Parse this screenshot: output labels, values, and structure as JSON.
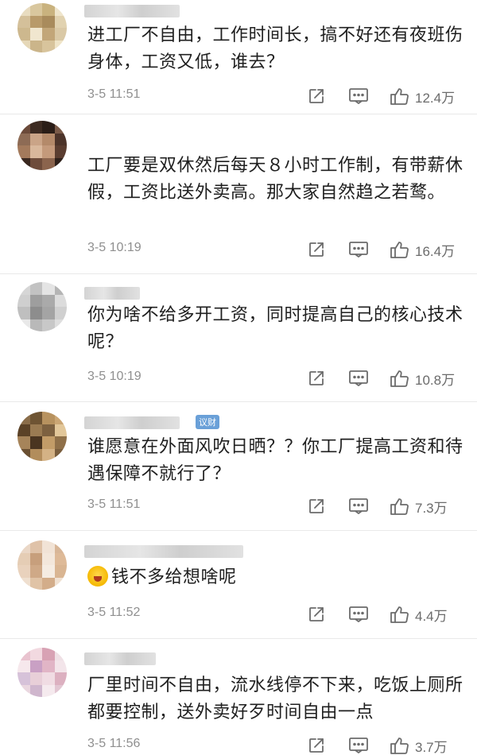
{
  "comments": [
    {
      "text": "进工厂不自由，工作时间长，搞不好还有夜班伤身体，工资又低，谁去？",
      "time": "3-5 11:51",
      "likes": "12.4万",
      "avatar_colors": [
        "#e8dcc0",
        "#d9c79e",
        "#c9b27e",
        "#efe5cc",
        "#d4c09a",
        "#b89a6a",
        "#a98b5c",
        "#e1d2b0",
        "#cdb88e",
        "#f0e6cf",
        "#c2a679",
        "#dac9a6",
        "#e6d8b8",
        "#cbb58a",
        "#d8c49c",
        "#efe4c8"
      ],
      "username_width": 120
    },
    {
      "text": "工厂要是双休然后每天８小时工作制，有带薪休假，工资比送外卖高。那大家自然趋之若鹜。",
      "time": "3-5 10:19",
      "likes": "16.4万",
      "avatar_colors": [
        "#6b4a3a",
        "#3d2b22",
        "#2a1d17",
        "#7a5a48",
        "#8d6b55",
        "#caa487",
        "#b48a6a",
        "#4c342a",
        "#a37a5c",
        "#d9b89c",
        "#c49a7b",
        "#5a3d30",
        "#3a2820",
        "#6e4c3b",
        "#8b644d",
        "#2f211b"
      ],
      "username_width": 0
    },
    {
      "text": "你为啥不给多开工资，同时提高自己的核心技术呢？",
      "time": "3-5 10:19",
      "likes": "10.8万",
      "avatar_colors": [
        "#d6d6d6",
        "#c2c2c2",
        "#e4e4e4",
        "#b5b5b5",
        "#cfcfcf",
        "#9e9e9e",
        "#aaaaaa",
        "#dcdcdc",
        "#bfbfbf",
        "#8d8d8d",
        "#a4a4a4",
        "#d0d0d0",
        "#e9e9e9",
        "#b9b9b9",
        "#c8c8c8",
        "#dedede"
      ],
      "username_width": 70
    },
    {
      "text": "谁愿意在外面风吹日晒？？你工厂提高工资和待遇保障不就行了？",
      "time": "3-5 11:51",
      "likes": "7.3万",
      "avatar_colors": [
        "#8a6d4a",
        "#6e5433",
        "#b7925f",
        "#cba674",
        "#5b4227",
        "#9a7b52",
        "#7d6140",
        "#e2c79a",
        "#a6845a",
        "#4a3520",
        "#c29c68",
        "#8f7049",
        "#6a5032",
        "#b28d5c",
        "#d4b285",
        "#7a5e3d"
      ],
      "username_width": 120,
      "badge": "议财"
    },
    {
      "text": "钱不多给想啥呢",
      "emoji": "scared-face",
      "time": "3-5 11:52",
      "likes": "4.4万",
      "avatar_colors": [
        "#ead7c6",
        "#dfc2a8",
        "#f1e3d6",
        "#d8b697",
        "#e5cdb5",
        "#c79f7c",
        "#f3e7db",
        "#deba98",
        "#e9d2bd",
        "#cfa987",
        "#f5ece2",
        "#d9b592",
        "#efdfcf",
        "#e0c3a6",
        "#d3ad8a",
        "#f0e1d2"
      ],
      "username_width": 200
    },
    {
      "text": "厂里时间不自由，流水线停不下来，吃饭上厕所都要控制，送外卖好歹时间自由一点",
      "time": "3-5 11:56",
      "likes": "3.7万",
      "avatar_colors": [
        "#e9c3cf",
        "#f2d9e0",
        "#d8a2b4",
        "#efe0e5",
        "#f6e8ec",
        "#c9a0c4",
        "#e1b5c6",
        "#f3e5ea",
        "#d6c2d9",
        "#e8cfd8",
        "#f0dce3",
        "#dcb0c0",
        "#ead7e0",
        "#cfb6cd",
        "#f5eaee",
        "#e2c6d2"
      ],
      "username_width": 90
    }
  ],
  "icons": {
    "share": "share-icon",
    "reply": "comment-icon",
    "like": "thumbs-up-icon"
  }
}
